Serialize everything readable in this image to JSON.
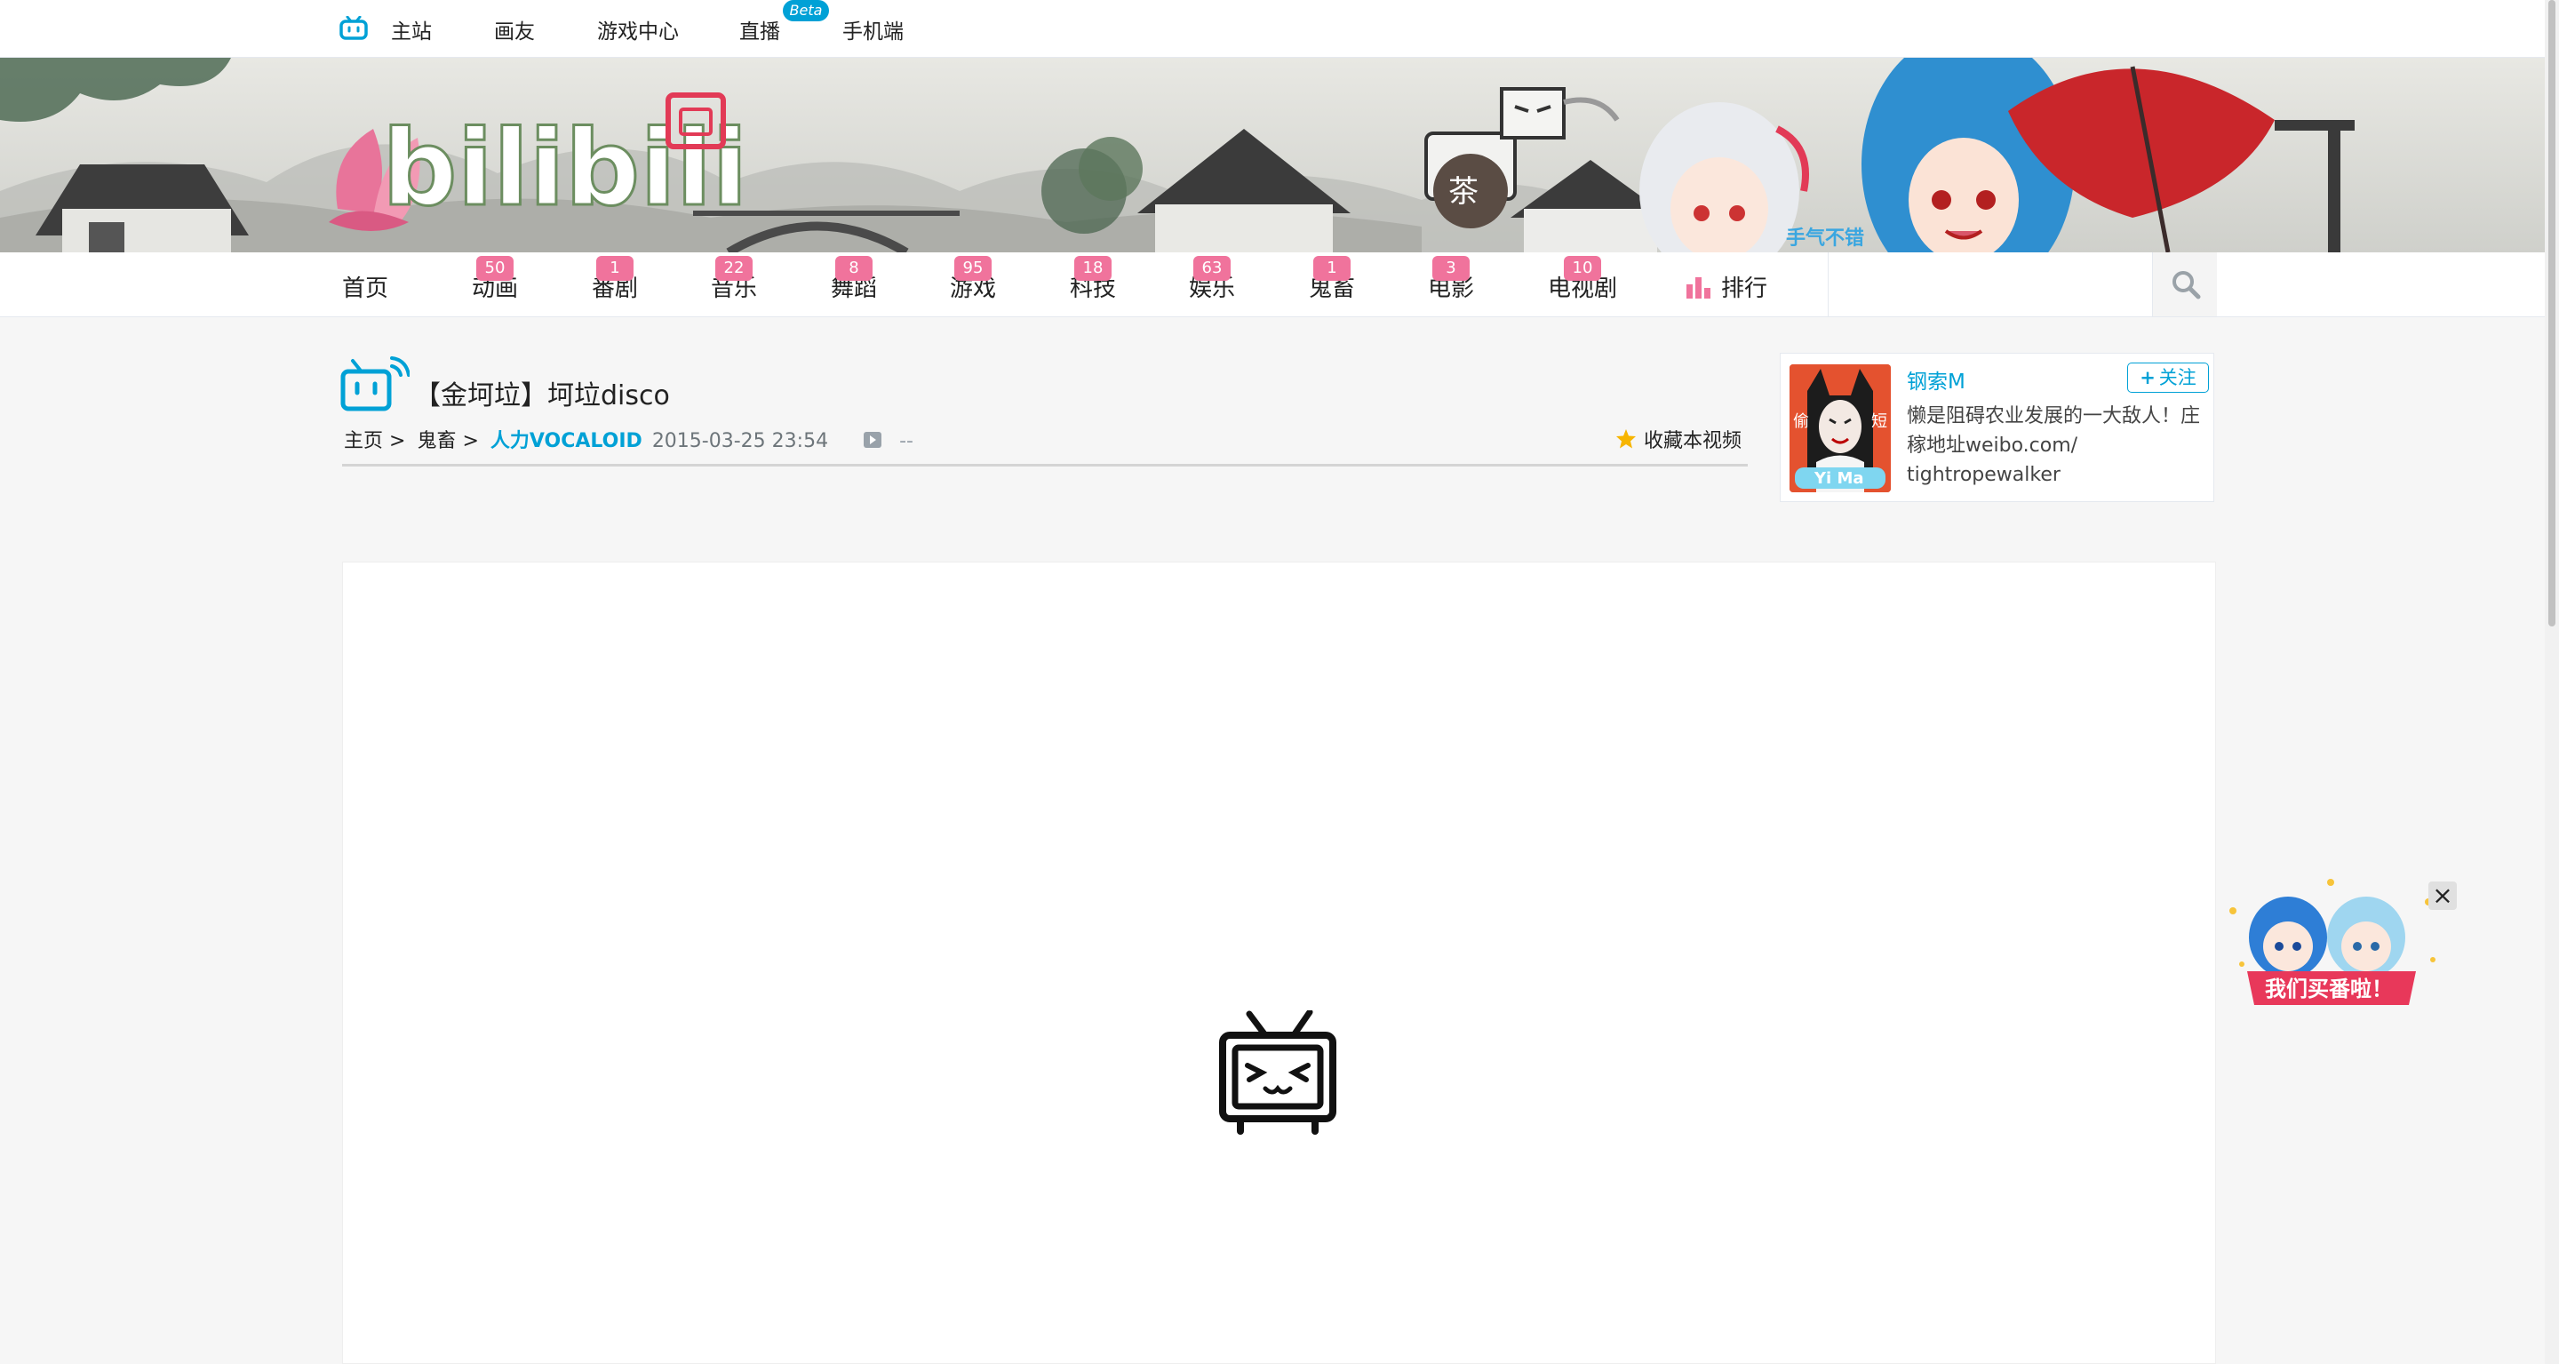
{
  "topbar": {
    "items": [
      "主站",
      "画友",
      "游戏中心",
      "直播",
      "手机端"
    ],
    "live_badge": "Beta"
  },
  "banner": {
    "logo_text": "bilibili",
    "tea_text": "茶",
    "sign_text": "手气不错"
  },
  "nav": {
    "items": [
      {
        "label": "首页",
        "count": ""
      },
      {
        "label": "动画",
        "count": "50"
      },
      {
        "label": "番剧",
        "count": "1"
      },
      {
        "label": "音乐",
        "count": "22"
      },
      {
        "label": "舞蹈",
        "count": "8"
      },
      {
        "label": "游戏",
        "count": "95"
      },
      {
        "label": "科技",
        "count": "18"
      },
      {
        "label": "娱乐",
        "count": "63"
      },
      {
        "label": "鬼畜",
        "count": "1"
      },
      {
        "label": "电影",
        "count": "3"
      },
      {
        "label": "电视剧",
        "count": "10"
      },
      {
        "label": "排行",
        "count": ""
      }
    ],
    "search_placeholder": ""
  },
  "video": {
    "title": "【金坷垃】坷垃disco",
    "breadcrumb": [
      "主页",
      ">",
      "鬼畜",
      ">"
    ],
    "category": "人力VOCALOID",
    "date": "2015-03-25 23:54",
    "plays": "--",
    "favorite_label": "收藏本视频"
  },
  "uploader": {
    "name": "钢索M",
    "follow_label": "关注",
    "desc_lines": [
      "懒是阻碍农业发展的一大敌人！庄",
      "稼地址weibo.com/",
      "tightropewalker"
    ],
    "avatar_text_left": "偷",
    "avatar_text_right": "短",
    "avatar_badge": "Yi Ma"
  },
  "float_ad": {
    "text": "我们买番啦！"
  },
  "colors": {
    "accent_blue": "#00a1d6",
    "badge_pink": "#f0739c",
    "banner_gray": "#d9d9d4"
  }
}
